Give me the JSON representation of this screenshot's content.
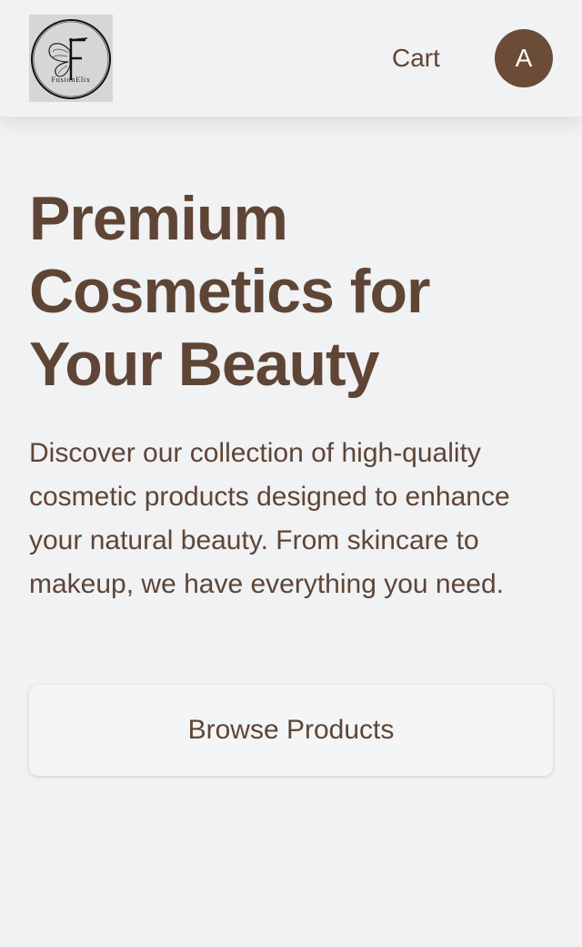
{
  "header": {
    "logo_text": "FusionElix",
    "cart_label": "Cart",
    "avatar_initial": "A"
  },
  "hero": {
    "title": "Premium Cosmetics for Your Beauty",
    "description": "Discover our collection of high-quality cosmetic products designed to enhance your natural beauty. From skincare to makeup, we have everything you need.",
    "cta_label": "Browse Products"
  },
  "colors": {
    "brand_brown": "#5f4535",
    "avatar_bg": "#6b4c38",
    "page_bg": "#f0f2f4"
  },
  "icons": {
    "logo": "butterfly-f-logo-icon"
  }
}
